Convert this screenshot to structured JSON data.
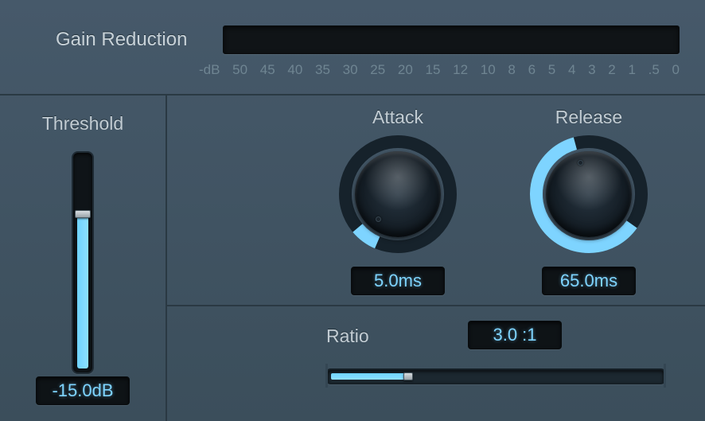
{
  "colors": {
    "accent": "#7ed4ff"
  },
  "gain_reduction": {
    "label": "Gain Reduction",
    "scale_prefix": "-dB",
    "scale": [
      "50",
      "45",
      "40",
      "35",
      "30",
      "25",
      "20",
      "15",
      "12",
      "10",
      "8",
      "6",
      "5",
      "4",
      "3",
      "2",
      "1",
      ".5",
      "0"
    ]
  },
  "threshold": {
    "label": "Threshold",
    "value_display": "-15.0dB",
    "fill_percent": 72
  },
  "attack": {
    "label": "Attack",
    "value_display": "5.0ms",
    "arc_start_deg": 203,
    "arc_end_deg": 230,
    "pointer_deg": 216
  },
  "release": {
    "label": "Release",
    "value_display": "65.0ms",
    "arc_start_deg": 125,
    "arc_end_deg": 345,
    "pointer_deg": 345
  },
  "ratio": {
    "label": "Ratio",
    "value_display": "3.0 :1",
    "fill_percent": 24
  }
}
